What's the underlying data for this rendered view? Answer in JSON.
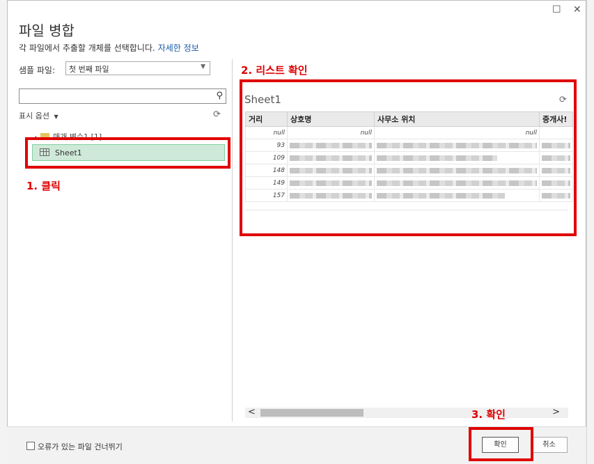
{
  "window": {
    "maximize_glyph": "☐",
    "close_glyph": "✕"
  },
  "dialog": {
    "title": "파일 병합",
    "subtitle": "각 파일에서 추출할 개체를 선택합니다.",
    "details_link": "자세한 정보",
    "sample_label": "샘플 파일:",
    "sample_value": "첫 번째 파일",
    "search_placeholder": "",
    "display_options": "표시 옵션",
    "folder_label": "매개 변수1 [1]",
    "sheet_item": "Sheet1"
  },
  "preview": {
    "title": "Sheet1",
    "columns": [
      "거리",
      "상호명",
      "사무소 위치",
      "중개사!"
    ],
    "rows": [
      [
        "null",
        "null",
        "null",
        ""
      ],
      [
        "93",
        "",
        "",
        ""
      ],
      [
        "109",
        "",
        "",
        ""
      ],
      [
        "148",
        "",
        "",
        ""
      ],
      [
        "149",
        "",
        "",
        ""
      ],
      [
        "157",
        "",
        "",
        ""
      ]
    ]
  },
  "footer": {
    "skip_errors": "오류가 있는 파일 건너뛰기",
    "ok": "확인",
    "cancel": "취소"
  },
  "annotations": {
    "step1": "1. 클릭",
    "step2": "2. 리스트 확인",
    "step3": "3. 확인"
  },
  "colors": {
    "annotation_red": "#e00000",
    "selected_item_bg": "#cfe9d9",
    "link_blue": "#1a5aa8"
  }
}
